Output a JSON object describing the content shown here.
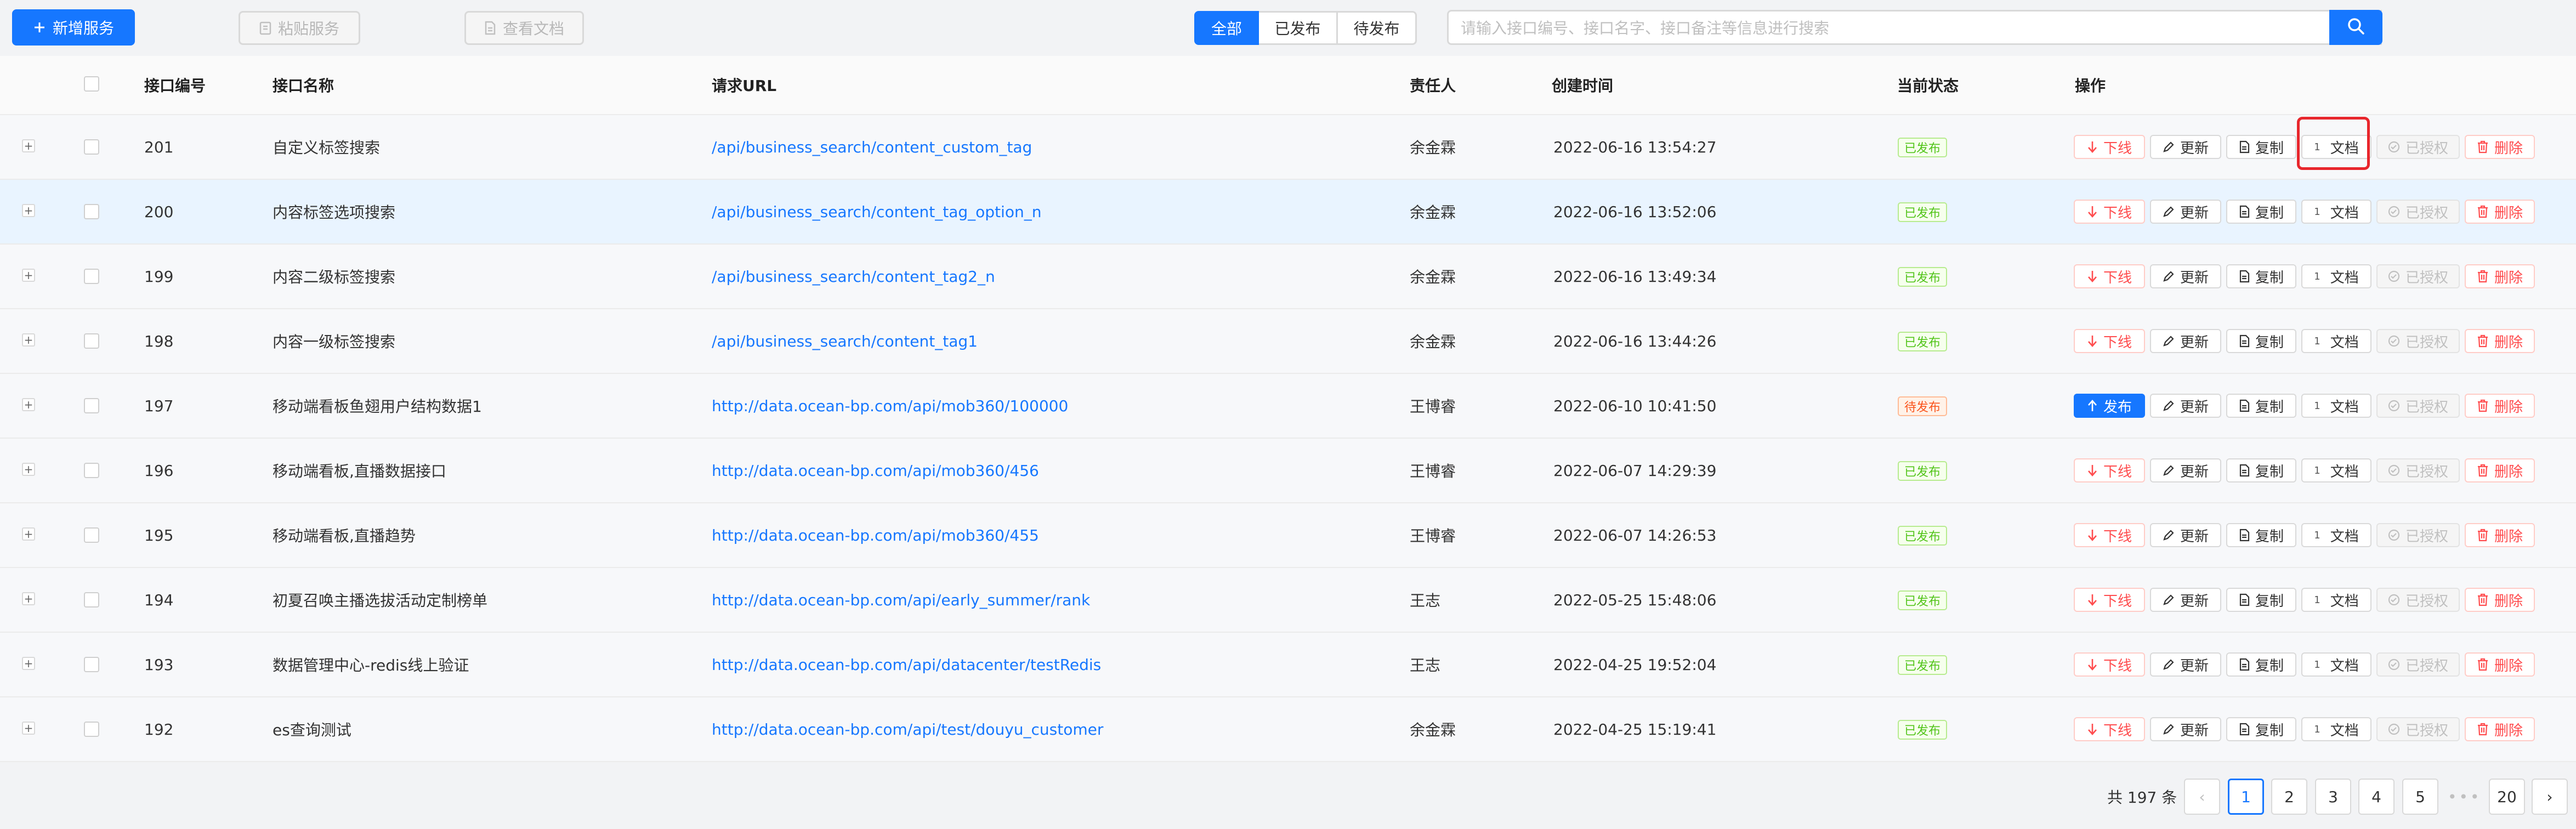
{
  "toolbar": {
    "add_label": "新增服务",
    "paste_label": "粘贴服务",
    "docs_label": "查看文档",
    "filter_tabs": [
      "全部",
      "已发布",
      "待发布"
    ],
    "search_placeholder": "请输入接口编号、接口名字、接口备注等信息进行搜索"
  },
  "colors": {
    "primary": "#1677ff",
    "danger": "#ff4d4f",
    "success": "#52c41a",
    "warning": "#fa541c",
    "highlight_box": "#e8262c"
  },
  "table": {
    "headers": {
      "id": "接口编号",
      "name": "接口名称",
      "url": "请求URL",
      "owner": "责任人",
      "created": "创建时间",
      "status": "当前状态",
      "actions": "操作"
    },
    "rows": [
      {
        "id": "201",
        "name": "自定义标签搜索",
        "url": "/api/business_search/content_custom_tag",
        "owner": "余金霖",
        "created": "2022-06-16 13:54:27",
        "status": "已发布",
        "first_action": "下线",
        "doc_count": "1"
      },
      {
        "id": "200",
        "name": "内容标签选项搜索",
        "url": "/api/business_search/content_tag_option_n",
        "owner": "余金霖",
        "created": "2022-06-16 13:52:06",
        "status": "已发布",
        "first_action": "下线",
        "doc_count": "1"
      },
      {
        "id": "199",
        "name": "内容二级标签搜索",
        "url": "/api/business_search/content_tag2_n",
        "owner": "余金霖",
        "created": "2022-06-16 13:49:34",
        "status": "已发布",
        "first_action": "下线",
        "doc_count": "1"
      },
      {
        "id": "198",
        "name": "内容一级标签搜索",
        "url": "/api/business_search/content_tag1",
        "owner": "余金霖",
        "created": "2022-06-16 13:44:26",
        "status": "已发布",
        "first_action": "下线",
        "doc_count": "1"
      },
      {
        "id": "197",
        "name": "移动端看板鱼翅用户结构数据1",
        "url": "http://data.ocean-bp.com/api/mob360/100000",
        "owner": "王博睿",
        "created": "2022-06-10 10:41:50",
        "status": "待发布",
        "first_action": "发布",
        "doc_count": "1"
      },
      {
        "id": "196",
        "name": "移动端看板,直播数据接口",
        "url": "http://data.ocean-bp.com/api/mob360/456",
        "owner": "王博睿",
        "created": "2022-06-07 14:29:39",
        "status": "已发布",
        "first_action": "下线",
        "doc_count": "1"
      },
      {
        "id": "195",
        "name": "移动端看板,直播趋势",
        "url": "http://data.ocean-bp.com/api/mob360/455",
        "owner": "王博睿",
        "created": "2022-06-07 14:26:53",
        "status": "已发布",
        "first_action": "下线",
        "doc_count": "1"
      },
      {
        "id": "194",
        "name": "初夏召唤主播选拔活动定制榜单",
        "url": "http://data.ocean-bp.com/api/early_summer/rank",
        "owner": "王志",
        "created": "2022-05-25 15:48:06",
        "status": "已发布",
        "first_action": "下线",
        "doc_count": "1"
      },
      {
        "id": "193",
        "name": "数据管理中心-redis线上验证",
        "url": "http://data.ocean-bp.com/api/datacenter/testRedis",
        "owner": "王志",
        "created": "2022-04-25 19:52:04",
        "status": "已发布",
        "first_action": "下线",
        "doc_count": "1"
      },
      {
        "id": "192",
        "name": "es查询测试",
        "url": "http://data.ocean-bp.com/api/test/douyu_customer",
        "owner": "余金霖",
        "created": "2022-04-25 15:19:41",
        "status": "已发布",
        "first_action": "下线",
        "doc_count": "1"
      }
    ],
    "actions": {
      "update": "更新",
      "copy": "复制",
      "doc": "文档",
      "authorized": "已授权",
      "delete": "删除"
    }
  },
  "pagination": {
    "total_text": "共 197 条",
    "pages": [
      "1",
      "2",
      "3",
      "4",
      "5"
    ],
    "current": "1",
    "ellipsis": "•••",
    "last_page": "20",
    "prev": "‹",
    "next": "›"
  }
}
